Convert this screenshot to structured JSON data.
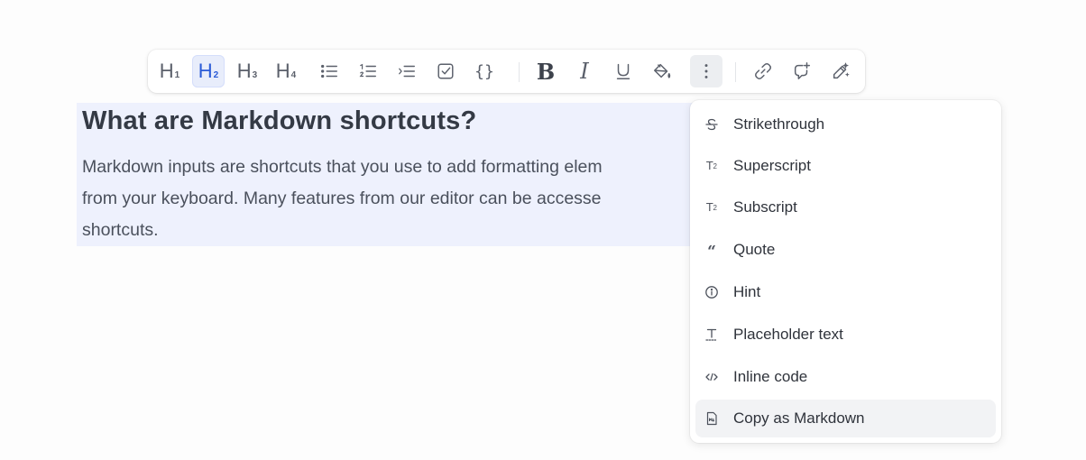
{
  "document": {
    "heading": "What are Markdown shortcuts?",
    "paragraph_lines": [
      "Markdown inputs are shortcuts that you use to add formatting elem",
      "from your keyboard. Many features from our editor can be accesse",
      "shortcuts."
    ]
  },
  "toolbar": {
    "h1": "H",
    "h1_sub": "1",
    "h2": "H",
    "h2_sub": "2",
    "h3": "H",
    "h3_sub": "3",
    "h4": "H",
    "h4_sub": "4",
    "code_block": "{}",
    "bold": "B",
    "italic": "I",
    "active_button": "heading-2",
    "open_button": "more-options"
  },
  "menu": {
    "items": [
      {
        "label": "Strikethrough",
        "icon": "strikethrough-icon"
      },
      {
        "label": "Superscript",
        "icon": "superscript-icon"
      },
      {
        "label": "Subscript",
        "icon": "subscript-icon"
      },
      {
        "label": "Quote",
        "icon": "quote-icon"
      },
      {
        "label": "Hint",
        "icon": "info-icon"
      },
      {
        "label": "Placeholder text",
        "icon": "placeholder-text-icon"
      },
      {
        "label": "Inline code",
        "icon": "inline-code-icon"
      },
      {
        "label": "Copy as Markdown",
        "icon": "markdown-file-icon"
      }
    ],
    "hovered_item": "Copy as Markdown"
  },
  "colors": {
    "selection": "#eef1fd",
    "active_accent": "#2a5bd7"
  }
}
